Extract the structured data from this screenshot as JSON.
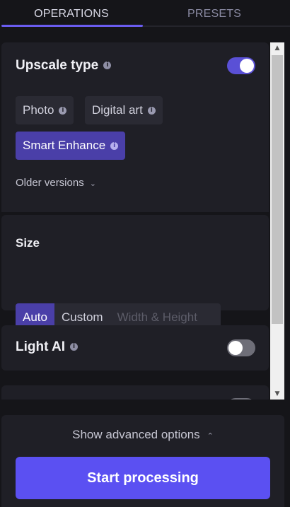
{
  "tabs": [
    {
      "label": "OPERATIONS",
      "active": true
    },
    {
      "label": "PRESETS",
      "active": false
    }
  ],
  "upscale": {
    "title": "Upscale type",
    "info_icon": "info-icon",
    "toggle_on": true,
    "options": [
      {
        "label": "Photo",
        "selected": false
      },
      {
        "label": "Digital art",
        "selected": false
      },
      {
        "label": "Smart Enhance",
        "selected": true
      }
    ],
    "older_versions": "Older versions"
  },
  "size": {
    "title": "Size",
    "options": [
      {
        "label": "Auto",
        "selected": true
      },
      {
        "label": "Custom",
        "selected": false
      },
      {
        "label": "Width & Height",
        "disabled": true
      }
    ]
  },
  "light_ai": {
    "title": "Light AI",
    "toggle_on": false
  },
  "bottom": {
    "advanced_label": "Show advanced options",
    "start_label": "Start processing"
  },
  "colors": {
    "accent": "#5b50f2",
    "selected_chip": "#4a3fa8",
    "panel": "#1f1f26",
    "background": "#151519"
  }
}
